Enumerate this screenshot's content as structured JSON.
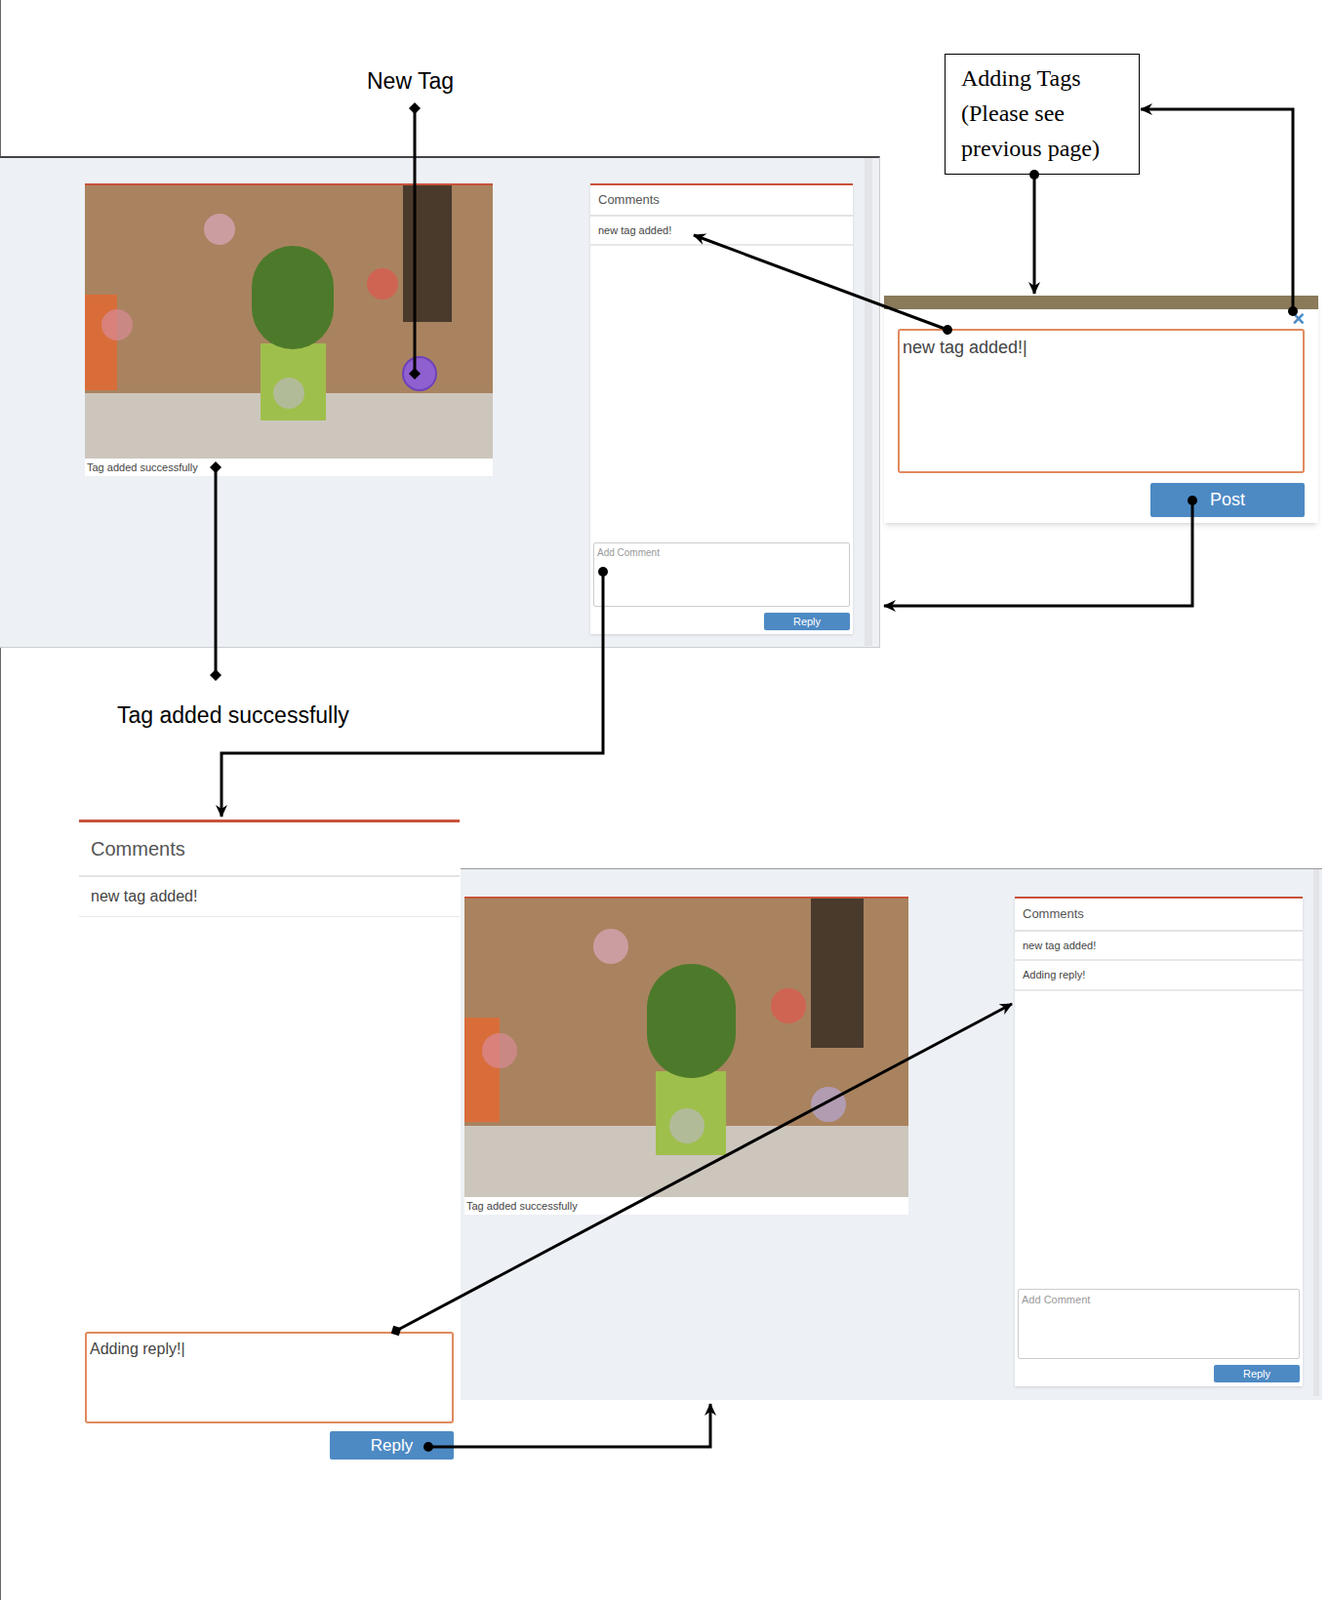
{
  "labels": {
    "new_tag": "New Tag",
    "tag_added": "Tag added successfully",
    "note_lines": [
      "Adding Tags",
      "(Please see",
      "previous page)"
    ]
  },
  "top_screen": {
    "photo": {
      "caption": "Tag added successfully",
      "tags": [
        {
          "selected": false,
          "color": "#d9a9bd"
        },
        {
          "selected": false,
          "color": "#e0574f"
        },
        {
          "selected": false,
          "color": "#d98a95"
        },
        {
          "selected": false,
          "color": "#b9b9b9"
        },
        {
          "selected": true,
          "color": "#8e5fd6"
        }
      ]
    },
    "comments": {
      "title": "Comments",
      "items": [
        "new tag added!"
      ],
      "placeholder": "Add Comment",
      "button": "Reply"
    }
  },
  "popup": {
    "close": "×",
    "value": "new tag added!",
    "button": "Post"
  },
  "reply_panel": {
    "title": "Comments",
    "items": [
      "new tag added!"
    ],
    "value": "Adding reply!",
    "button": "Reply"
  },
  "bottom_screen": {
    "photo": {
      "caption": "Tag added successfully",
      "tags": [
        {
          "selected": false,
          "color": "#d9a9bd"
        },
        {
          "selected": false,
          "color": "#e0574f"
        },
        {
          "selected": false,
          "color": "#d98a95"
        },
        {
          "selected": false,
          "color": "#b9b9b9"
        },
        {
          "selected": false,
          "color": "#b7a6d6"
        }
      ]
    },
    "comments": {
      "title": "Comments",
      "items": [
        "new tag added!",
        "Adding reply!"
      ],
      "placeholder": "Add Comment",
      "button": "Reply"
    }
  }
}
